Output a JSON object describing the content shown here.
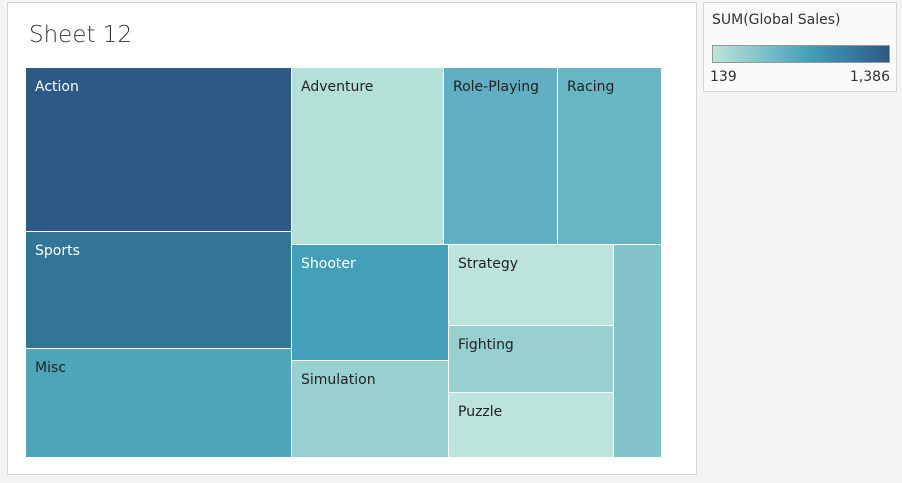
{
  "sheet_title": "Sheet 12",
  "chart_data": {
    "type": "treemap",
    "title": "Sheet 12",
    "color_measure": "SUM(Global Sales)",
    "color_range": [
      139,
      1386
    ],
    "cells": [
      {
        "label": "Action",
        "color": "#2c5985",
        "text_color": "#ffffff"
      },
      {
        "label": "Sports",
        "color": "#327597",
        "text_color": "#ffffff"
      },
      {
        "label": "Misc",
        "color": "#4ea5b9",
        "text_color": "#222222"
      },
      {
        "label": "Adventure",
        "color": "#b3e0d7",
        "text_color": "#222222"
      },
      {
        "label": "Role-Playing",
        "color": "#62aec2",
        "text_color": "#222222"
      },
      {
        "label": "Racing",
        "color": "#6ab5c4",
        "text_color": "#222222"
      },
      {
        "label": "Shooter",
        "color": "#439fb8",
        "text_color": "#ffffff"
      },
      {
        "label": "Simulation",
        "color": "#98d0d1",
        "text_color": "#222222"
      },
      {
        "label": "Strategy",
        "color": "#bde4da",
        "text_color": "#222222"
      },
      {
        "label": "Fighting",
        "color": "#98cfcf",
        "text_color": "#222222"
      },
      {
        "label": "Puzzle",
        "color": "#bde4da",
        "text_color": "#222222"
      },
      {
        "label": "",
        "color": "#82c3cb",
        "text_color": "#222222"
      }
    ]
  },
  "legend": {
    "title": "SUM(Global Sales)",
    "min_label": "139",
    "max_label": "1,386"
  }
}
